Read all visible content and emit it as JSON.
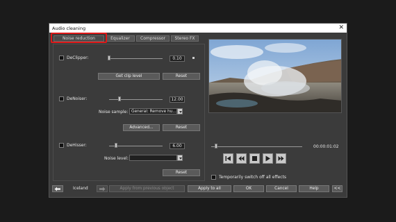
{
  "window": {
    "title": "Audio cleaning",
    "close_glyph": "✕"
  },
  "tabs": [
    {
      "label": "Noise reduction",
      "active": true
    },
    {
      "label": "Equalizer",
      "active": false
    },
    {
      "label": "Compressor",
      "active": false
    },
    {
      "label": "Stereo FX",
      "active": false
    }
  ],
  "declipper": {
    "label": "DeClipper:",
    "value": "0.10",
    "slider_level": 0.0,
    "get_clip_button": "Get clip level",
    "reset_button": "Reset"
  },
  "denoiser": {
    "label": "DeNoiser:",
    "value": "12.00",
    "slider_level": 0.2,
    "noise_sample_label": "Noise sample:",
    "noise_sample_value": "General: Remove hu...",
    "advanced_button": "Advanced...",
    "reset_button": "Reset"
  },
  "dehisser": {
    "label": "DeHisser:",
    "value": "6.00",
    "slider_level": 0.13,
    "noise_level_label": "Noise level:",
    "noise_level_value": "",
    "reset_button": "Reset"
  },
  "preview": {
    "timecode": "00:00:01:02",
    "position_fraction": 0.05,
    "bypass_label": "Temporarily switch off all effects"
  },
  "transport": [
    "skip-to-start-icon",
    "rewind-icon",
    "stop-icon",
    "play-icon",
    "fast-forward-icon"
  ],
  "footer": {
    "object_name": "Iceland",
    "apply_previous_button": "Apply from previous object",
    "apply_all_button": "Apply to all",
    "ok_button": "OK",
    "cancel_button": "Cancel",
    "help_button": "Help",
    "collapse_button": "<<"
  }
}
